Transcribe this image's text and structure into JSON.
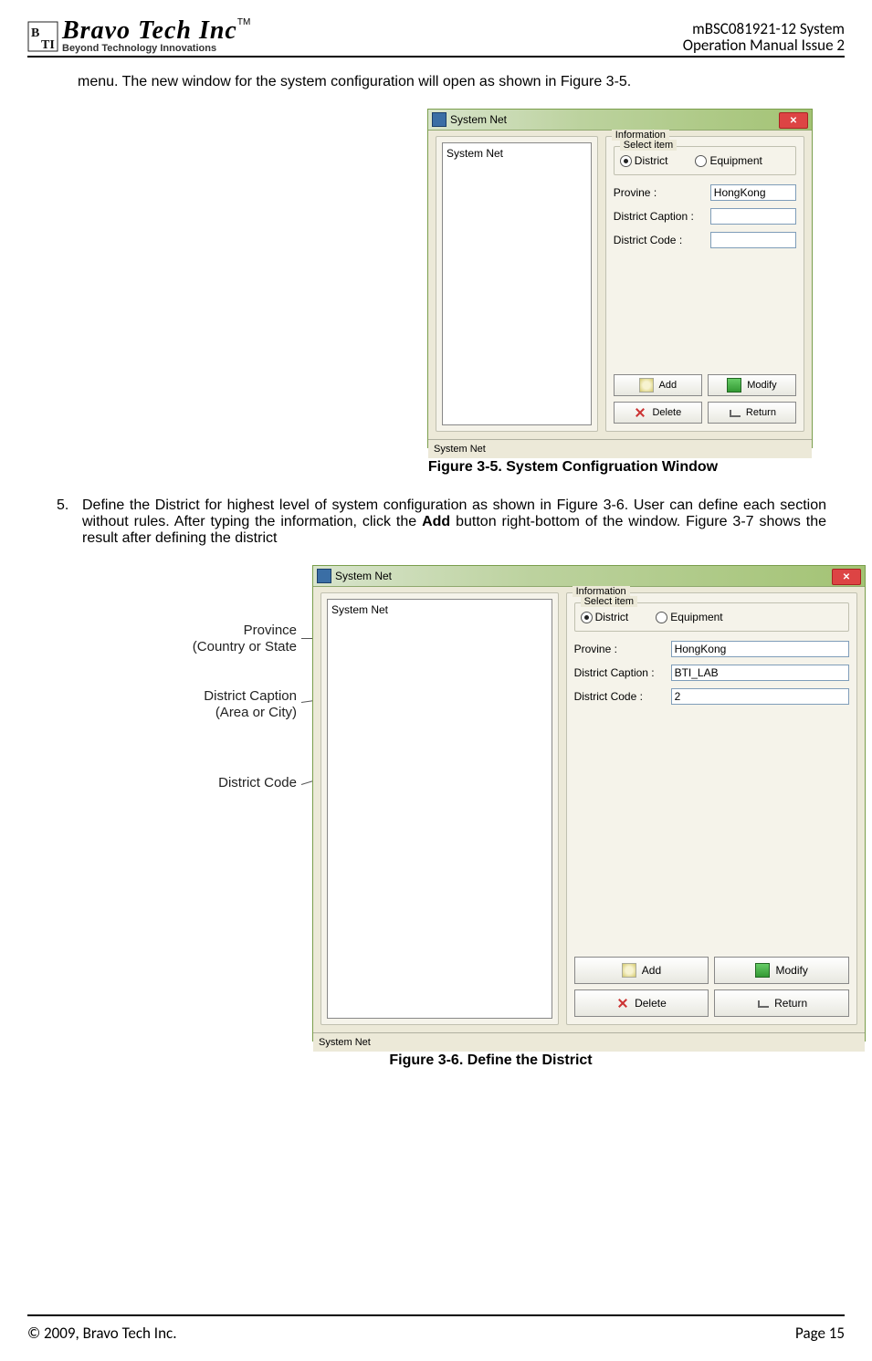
{
  "header": {
    "logo_main": "Bravo Tech Inc",
    "logo_tm": "TM",
    "logo_slogan": "Beyond Technology Innovations",
    "doc_title_line1": "mBSC081921-12 System",
    "doc_title_line2": "Operation Manual Issue 2"
  },
  "intro_paragraph": "menu. The new window for the system configuration will open as shown in Figure 3-5.",
  "figure1": {
    "window_title": "System Net",
    "tree_root": "System Net",
    "info_legend": "Information",
    "select_item_legend": "Select item",
    "radio_district": "District",
    "radio_equipment": "Equipment",
    "label_province": "Provine :",
    "value_province": "HongKong",
    "label_district_caption": "District Caption :",
    "value_district_caption": "",
    "label_district_code": "District Code :",
    "value_district_code": "",
    "btn_add": "Add",
    "btn_modify": "Modify",
    "btn_delete": "Delete",
    "btn_return": "Return",
    "status": "System Net",
    "caption": "Figure 3-5. System Configruation Window"
  },
  "step5": {
    "number": "5.",
    "text_before_bold": "Define the District for highest level of system configuration as shown in Figure 3-6. User can define each section without rules. After typing the information, click the ",
    "bold_word": "Add",
    "text_after_bold": " button right-bottom of the window. Figure 3-7 shows the result after defining the district"
  },
  "annotations": {
    "a1_line1": "Province",
    "a1_line2": "(Country or State",
    "a2_line1": "District Caption",
    "a2_line2": "(Area or City)",
    "a3_line1": "District Code"
  },
  "figure2": {
    "window_title": "System Net",
    "tree_root": "System Net",
    "info_legend": "Information",
    "select_item_legend": "Select item",
    "radio_district": "District",
    "radio_equipment": "Equipment",
    "label_province": "Provine :",
    "value_province": "HongKong",
    "label_district_caption": "District Caption :",
    "value_district_caption": "BTI_LAB",
    "label_district_code": "District Code :",
    "value_district_code": "2",
    "btn_add": "Add",
    "btn_modify": "Modify",
    "btn_delete": "Delete",
    "btn_return": "Return",
    "status": "System Net",
    "caption": "Figure 3-6. Define the District"
  },
  "footer": {
    "copyright": "© 2009, Bravo Tech Inc.",
    "page": "Page 15"
  }
}
